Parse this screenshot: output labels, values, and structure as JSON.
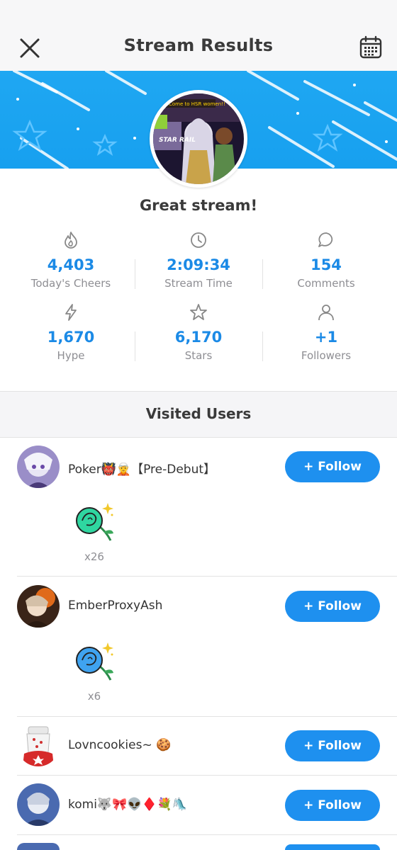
{
  "header": {
    "title": "Stream Results",
    "close_icon": "close-icon",
    "calendar_icon": "calendar-icon"
  },
  "banner": {
    "accent_color": "#1fa7f2",
    "avatar_caption": "Come to HSR women!!",
    "avatar_logo": "STAR RAIL"
  },
  "summary": {
    "message": "Great stream!"
  },
  "stats": [
    {
      "icon": "flame-icon",
      "value": "4,403",
      "label": "Today's Cheers"
    },
    {
      "icon": "clock-icon",
      "value": "2:09:34",
      "label": "Stream Time"
    },
    {
      "icon": "comment-icon",
      "value": "154",
      "label": "Comments"
    },
    {
      "icon": "lightning-icon",
      "value": "1,670",
      "label": "Hype"
    },
    {
      "icon": "star-icon",
      "value": "6,170",
      "label": "Stars"
    },
    {
      "icon": "person-icon",
      "value": "+1",
      "label": "Followers"
    }
  ],
  "visited": {
    "title": "Visited Users",
    "follow_label": "+ Follow",
    "users": [
      {
        "name": "Poker👹🧝【Pre-Debut】",
        "gift": "green-rose-icon",
        "gift_color": "#2fd6a0",
        "count": "x26"
      },
      {
        "name": "EmberProxyAsh",
        "gift": "blue-rose-icon",
        "gift_color": "#3fa3f0",
        "count": "x6"
      },
      {
        "name": "Lovncookies~ 🍪",
        "gift": "",
        "count": ""
      },
      {
        "name": "komi🐺🎀👽♦️💐🛝",
        "gift": "",
        "count": ""
      }
    ]
  }
}
